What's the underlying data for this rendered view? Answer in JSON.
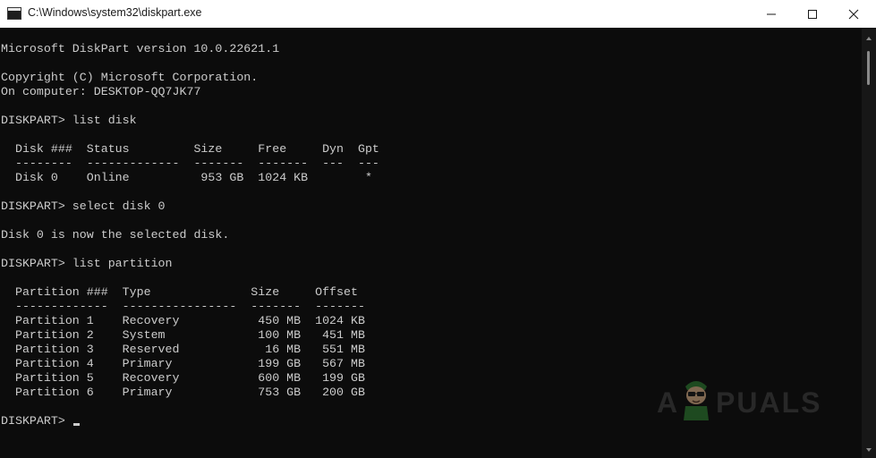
{
  "window": {
    "title": "C:\\Windows\\system32\\diskpart.exe",
    "controls": {
      "minimize": "minimize-icon",
      "maximize": "maximize-icon",
      "close": "close-icon"
    }
  },
  "console": {
    "lines": [
      "Microsoft DiskPart version 10.0.22621.1",
      "",
      "Copyright (C) Microsoft Corporation.",
      "On computer: DESKTOP-QQ7JK77",
      "",
      "DISKPART> list disk",
      "",
      "  Disk ###  Status         Size     Free     Dyn  Gpt",
      "  --------  -------------  -------  -------  ---  ---",
      "  Disk 0    Online          953 GB  1024 KB        *",
      "",
      "DISKPART> select disk 0",
      "",
      "Disk 0 is now the selected disk.",
      "",
      "DISKPART> list partition",
      "",
      "  Partition ###  Type              Size     Offset",
      "  -------------  ----------------  -------  -------",
      "  Partition 1    Recovery           450 MB  1024 KB",
      "  Partition 2    System             100 MB   451 MB",
      "  Partition 3    Reserved            16 MB   551 MB",
      "  Partition 4    Primary            199 GB   567 MB",
      "  Partition 5    Recovery           600 MB   199 GB",
      "  Partition 6    Primary            753 GB   200 GB",
      ""
    ],
    "prompt": "DISKPART> "
  },
  "watermark": {
    "first": "A",
    "rest": "PUALS"
  },
  "colors": {
    "console_bg": "#0c0c0c",
    "console_text": "#cccccc",
    "titlebar_bg": "#ffffff"
  }
}
